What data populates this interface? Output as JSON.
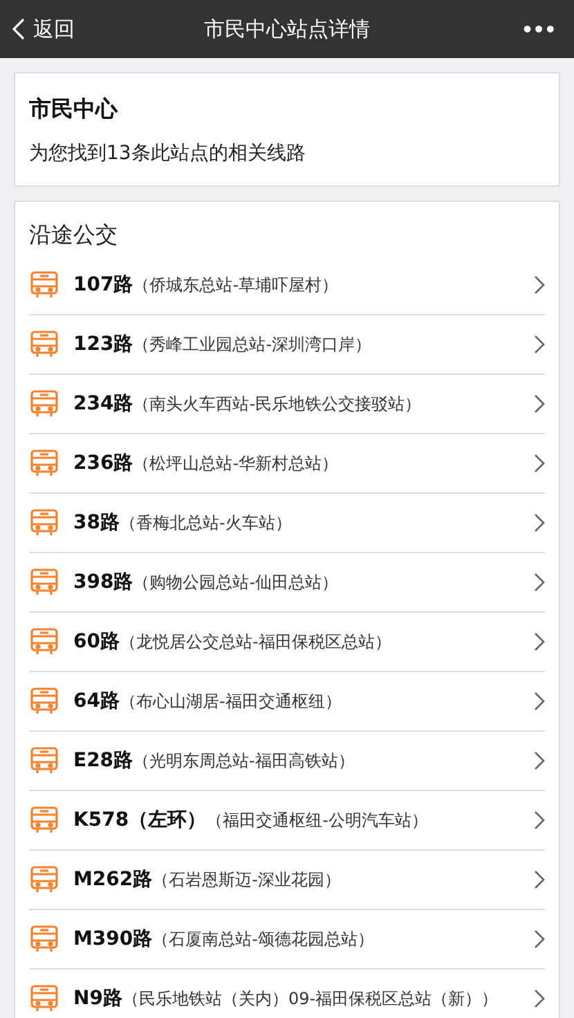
{
  "nav": {
    "back": "返回",
    "title": "市民中心站点详情",
    "more": "•••"
  },
  "station": {
    "name": "市民中心",
    "summary": "为您找到13条此站点的相关线路"
  },
  "section_title": "沿途公交",
  "routes": [
    {
      "name": "107路",
      "terminals": "（侨城东总站-草埔吓屋村）"
    },
    {
      "name": "123路",
      "terminals": "（秀峰工业园总站-深圳湾口岸）"
    },
    {
      "name": "234路",
      "terminals": "（南头火车西站-民乐地铁公交接驳站）"
    },
    {
      "name": "236路",
      "terminals": "（松坪山总站-华新村总站）"
    },
    {
      "name": "38路",
      "terminals": "（香梅北总站-火车站）"
    },
    {
      "name": "398路",
      "terminals": "（购物公园总站-仙田总站）"
    },
    {
      "name": "60路",
      "terminals": "（龙悦居公交总站-福田保税区总站）"
    },
    {
      "name": "64路",
      "terminals": "（布心山湖居-福田交通枢纽）"
    },
    {
      "name": "E28路",
      "terminals": "（光明东周总站-福田高铁站）"
    },
    {
      "name": "K578（左环）",
      "terminals": "（福田交通枢纽-公明汽车站）"
    },
    {
      "name": "M262路",
      "terminals": "（石岩恩斯迈-深业花园）"
    },
    {
      "name": "M390路",
      "terminals": "（石厦南总站-颂德花园总站）"
    },
    {
      "name": "N9路",
      "terminals": "（民乐地铁站（关内）09-福田保税区总站（新））"
    }
  ]
}
